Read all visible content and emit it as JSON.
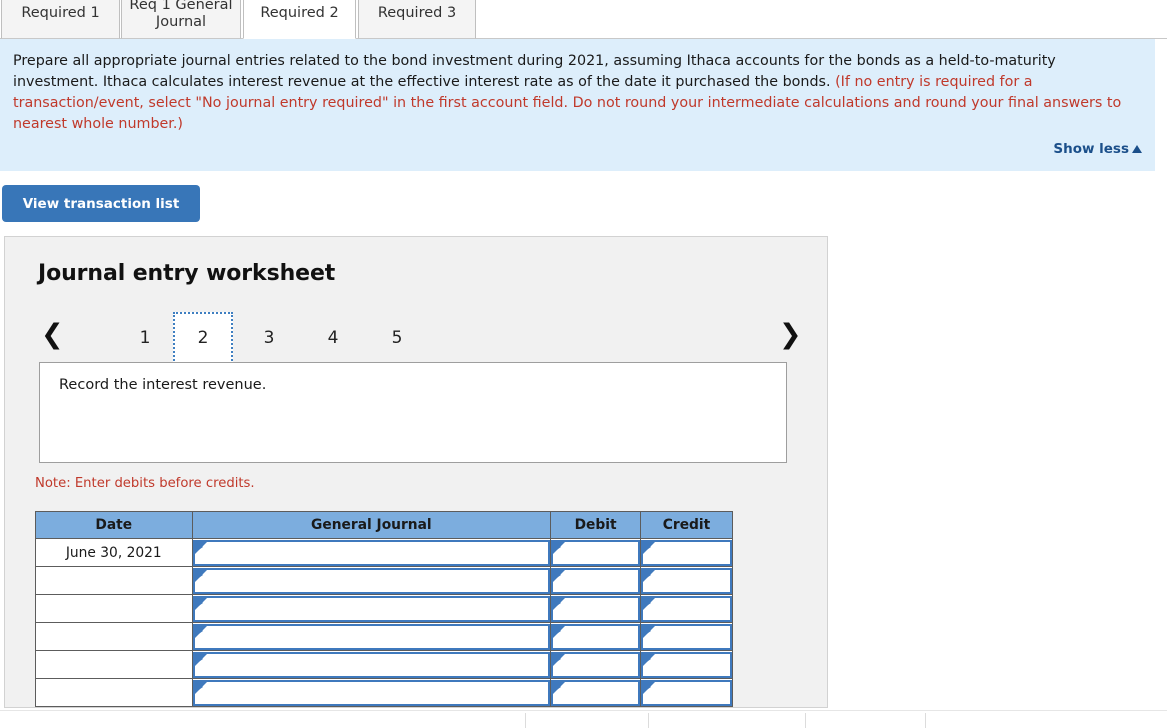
{
  "tabs": [
    {
      "label": "Required 1",
      "active": false
    },
    {
      "label": "Req 1 General Journal",
      "active": false
    },
    {
      "label": "Required 2",
      "active": true
    },
    {
      "label": "Required 3",
      "active": false
    }
  ],
  "instructions": {
    "black_text": "Prepare all appropriate journal entries related to the bond investment during 2021, assuming Ithaca accounts for the bonds as a held-to-maturity investment. Ithaca calculates interest revenue at the effective interest rate as of the date it purchased the bonds. ",
    "red_text": "(If no entry is required for a transaction/event, select \"No journal entry required\" in the first account field. Do not round your intermediate calculations and round your final answers to nearest whole number.)",
    "show_less_label": "Show less",
    "background_color": "#ddeefb",
    "red_color": "#c0392b"
  },
  "toolbar": {
    "view_transaction_list_label": "View transaction list",
    "button_color": "#3876b8"
  },
  "worksheet": {
    "title": "Journal entry worksheet",
    "pager": {
      "prev_icon": "chevron-left-icon",
      "next_icon": "chevron-right-icon",
      "pages": [
        "1",
        "2",
        "3",
        "4",
        "5"
      ],
      "active_page": "2"
    },
    "description": "Record the interest revenue.",
    "note": "Note: Enter debits before credits.",
    "table": {
      "headers": [
        "Date",
        "General Journal",
        "Debit",
        "Credit"
      ],
      "header_color": "#7cadde",
      "rows": [
        {
          "date": "June 30, 2021",
          "general_journal": "",
          "debit": "",
          "credit": ""
        },
        {
          "date": "",
          "general_journal": "",
          "debit": "",
          "credit": ""
        },
        {
          "date": "",
          "general_journal": "",
          "debit": "",
          "credit": ""
        },
        {
          "date": "",
          "general_journal": "",
          "debit": "",
          "credit": ""
        },
        {
          "date": "",
          "general_journal": "",
          "debit": "",
          "credit": ""
        },
        {
          "date": "",
          "general_journal": "",
          "debit": "",
          "credit": ""
        }
      ]
    }
  }
}
